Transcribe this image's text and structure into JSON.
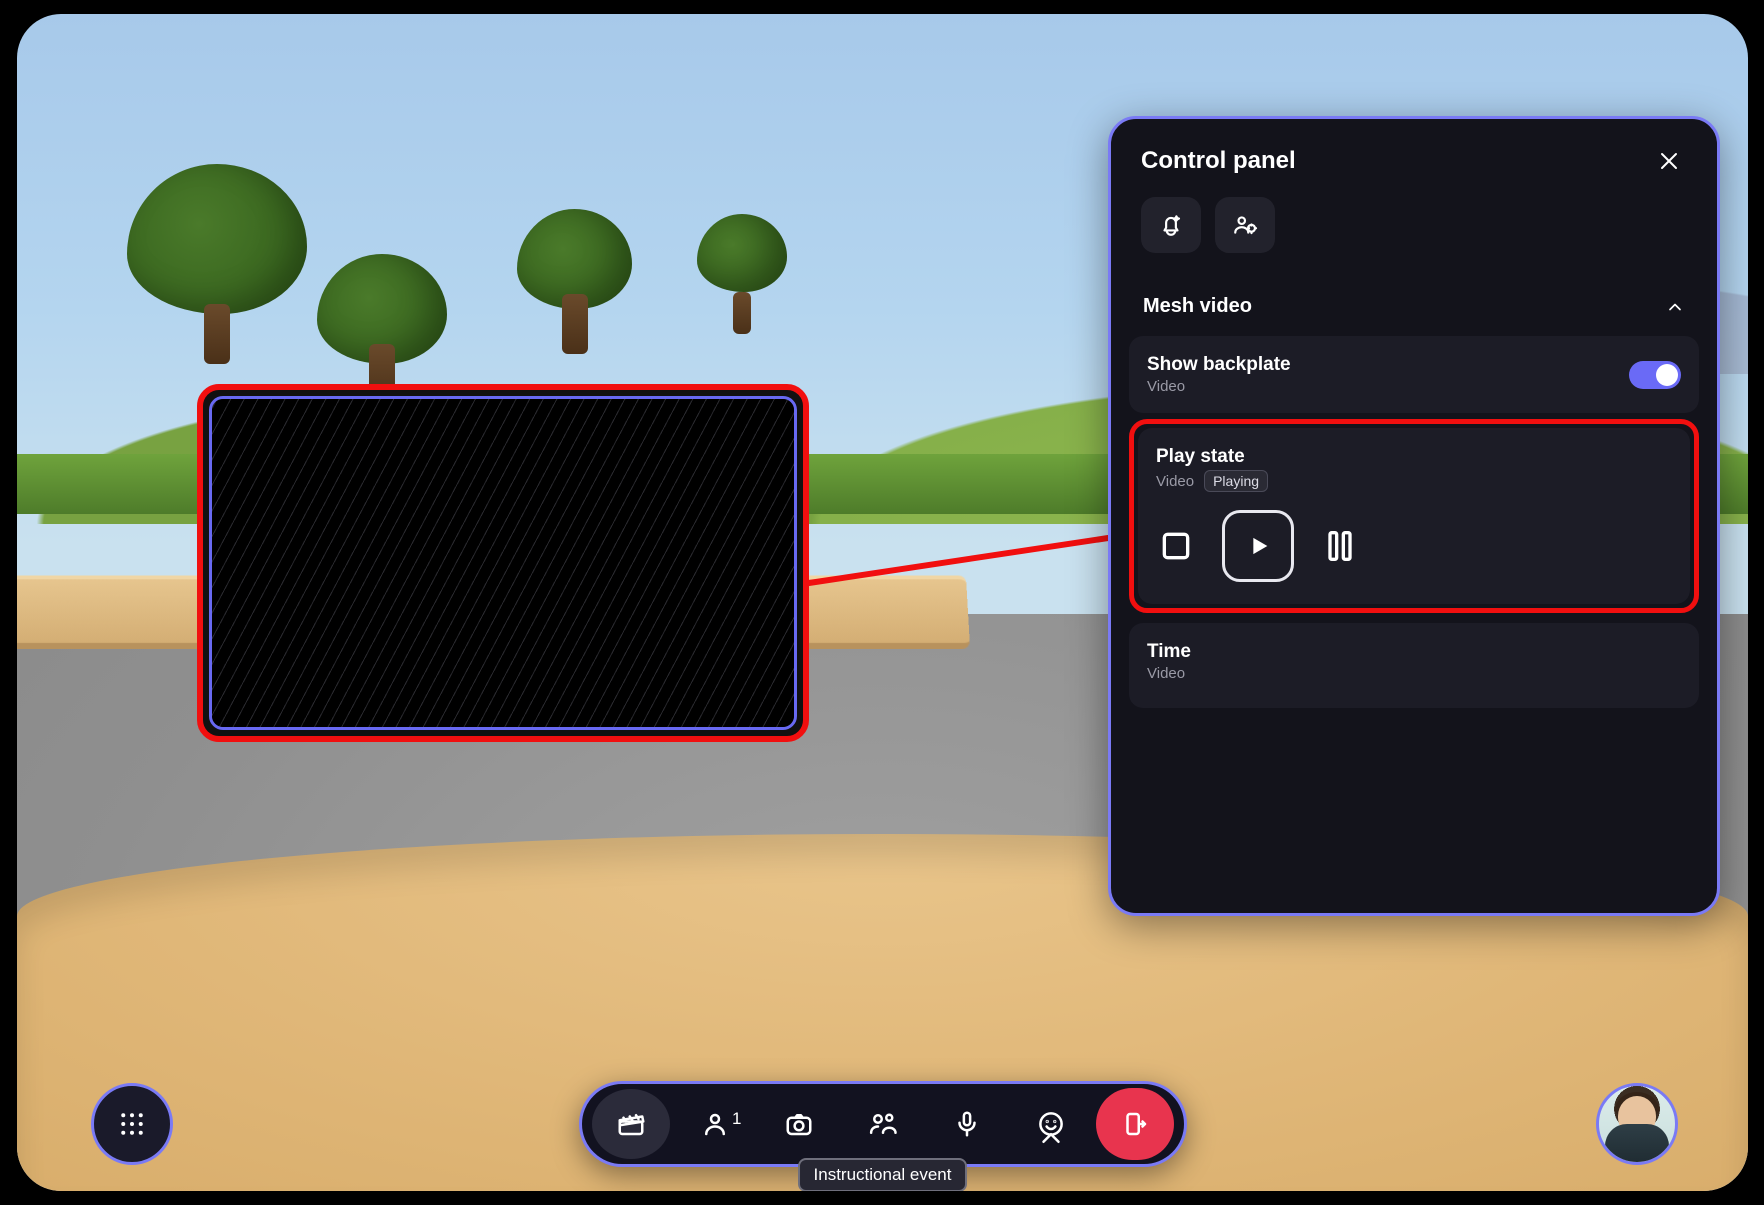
{
  "panel": {
    "title": "Control panel",
    "section_title": "Mesh video",
    "backplate": {
      "label": "Show backplate",
      "sublabel": "Video",
      "enabled": true
    },
    "playstate": {
      "label": "Play state",
      "sublabel": "Video",
      "status": "Playing"
    },
    "time": {
      "label": "Time",
      "sublabel": "Video"
    }
  },
  "bottombar": {
    "people_count": "1",
    "tooltip": "Instructional event"
  },
  "colors": {
    "accent": "#7a7af5",
    "highlight": "#f10f0f",
    "danger": "#e8344e"
  }
}
